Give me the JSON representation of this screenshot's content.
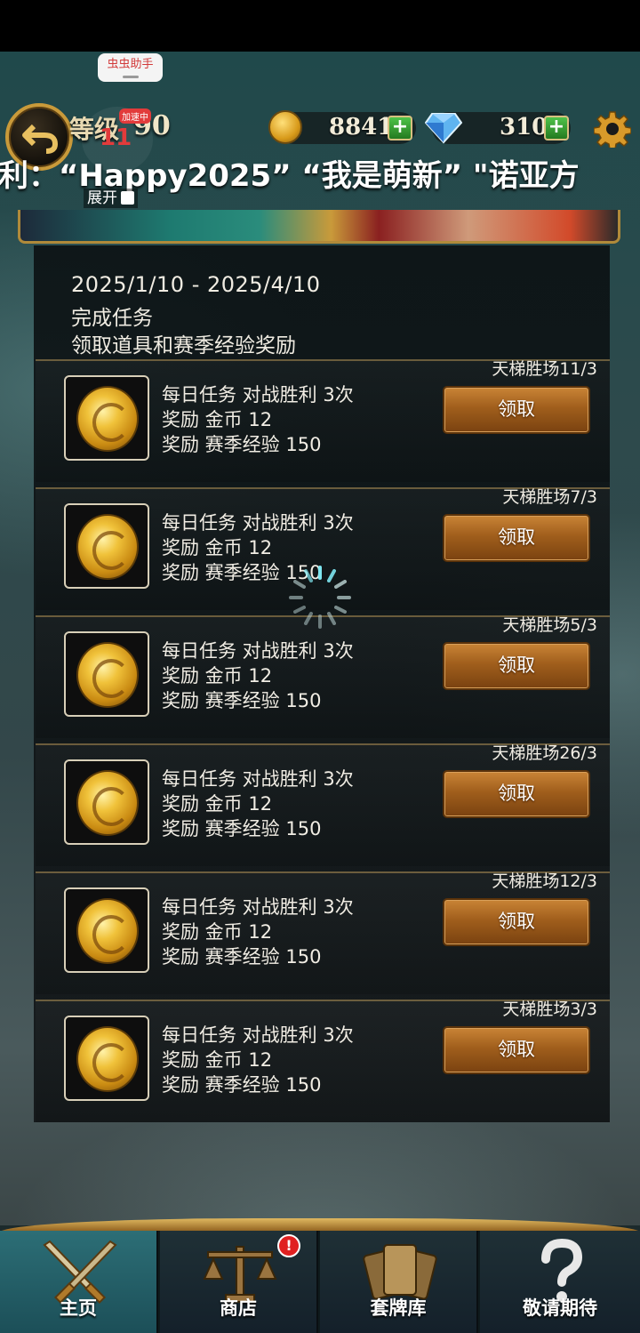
{
  "helper_tag": "虫虫助手",
  "top_bar": {
    "level_label": "等级",
    "level_value": "90",
    "speed_badge": "加速中",
    "speed_number": "11",
    "gold": "8841",
    "gems": "310"
  },
  "ticker_text": "利：“Happy2025” “我是萌新” \"诺亚方",
  "expand_label": "展开",
  "event": {
    "date_range": "2025/1/10  - 2025/4/10",
    "desc_1": "完成任务",
    "desc_2": "领取道具和赛季经验奖励"
  },
  "tasks": [
    {
      "progress": "天梯胜场11/3",
      "line1": "每日任务 对战胜利 3次",
      "line2": "奖励 金币  12",
      "line3": "奖励 赛季经验  150",
      "button": "领取"
    },
    {
      "progress": "天梯胜场7/3",
      "line1": "每日任务 对战胜利 3次",
      "line2": "奖励 金币  12",
      "line3": "奖励 赛季经验  150",
      "button": "领取"
    },
    {
      "progress": "天梯胜场5/3",
      "line1": "每日任务 对战胜利 3次",
      "line2": "奖励 金币  12",
      "line3": "奖励 赛季经验  150",
      "button": "领取"
    },
    {
      "progress": "天梯胜场26/3",
      "line1": "每日任务 对战胜利 3次",
      "line2": "奖励 金币  12",
      "line3": "奖励 赛季经验  150",
      "button": "领取"
    },
    {
      "progress": "天梯胜场12/3",
      "line1": "每日任务 对战胜利 3次",
      "line2": "奖励 金币  12",
      "line3": "奖励 赛季经验  150",
      "button": "领取"
    },
    {
      "progress": "天梯胜场3/3",
      "line1": "每日任务 对战胜利 3次",
      "line2": "奖励 金币  12",
      "line3": "奖励 赛季经验  150",
      "button": "领取"
    }
  ],
  "bottom_nav": [
    {
      "label": "主页",
      "icon": "crossed-swords-icon",
      "active": true
    },
    {
      "label": "商店",
      "icon": "scales-icon",
      "active": false
    },
    {
      "label": "套牌库",
      "icon": "cards-icon",
      "active": false
    },
    {
      "label": "敬请期待",
      "icon": "question-mark-icon",
      "active": false
    }
  ],
  "shop_badge": "!",
  "colors": {
    "accent_gold": "#c99a3a",
    "claim_button": "#a05e1c",
    "active_tab": "#2c6e76",
    "badge_red": "#e02020"
  }
}
